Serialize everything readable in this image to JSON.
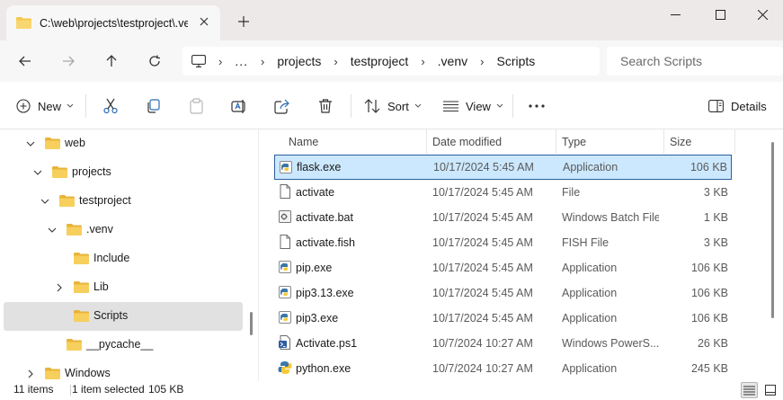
{
  "window": {
    "tab_title": "C:\\web\\projects\\testproject\\.venv\\Scripts",
    "colors": {
      "accent": "#0067c0",
      "folder": "#f4c84b",
      "selection": "#cce8ff",
      "selection_border": "#2b5f9e"
    }
  },
  "address": {
    "breadcrumbs": [
      "...",
      "projects",
      "testproject",
      ".venv",
      "Scripts"
    ],
    "search_placeholder": "Search Scripts"
  },
  "toolbar": {
    "new_label": "New",
    "sort_label": "Sort",
    "view_label": "View",
    "more_label": "...",
    "details_label": "Details"
  },
  "nav_tree": [
    {
      "label": "web",
      "expanded": true
    },
    {
      "label": "projects",
      "expanded": true
    },
    {
      "label": "testproject",
      "expanded": true
    },
    {
      "label": ".venv",
      "expanded": true
    },
    {
      "label": "Include",
      "expanded": null
    },
    {
      "label": "Lib",
      "expanded": false
    },
    {
      "label": "Scripts",
      "expanded": null,
      "selected": true
    },
    {
      "label": "__pycache__",
      "expanded": null
    },
    {
      "label": "Windows",
      "expanded": false
    }
  ],
  "columns": {
    "name": "Name",
    "date": "Date modified",
    "type": "Type",
    "size": "Size"
  },
  "files": [
    {
      "name": "flask.exe",
      "date": "10/17/2024 5:45 AM",
      "type": "Application",
      "size": "106 KB",
      "icon": "python-exe-icon",
      "selected": true
    },
    {
      "name": "activate",
      "date": "10/17/2024 5:45 AM",
      "type": "File",
      "size": "3 KB",
      "icon": "file-icon"
    },
    {
      "name": "activate.bat",
      "date": "10/17/2024 5:45 AM",
      "type": "Windows Batch File",
      "size": "1 KB",
      "icon": "batch-file-icon"
    },
    {
      "name": "activate.fish",
      "date": "10/17/2024 5:45 AM",
      "type": "FISH File",
      "size": "3 KB",
      "icon": "file-icon"
    },
    {
      "name": "pip.exe",
      "date": "10/17/2024 5:45 AM",
      "type": "Application",
      "size": "106 KB",
      "icon": "python-exe-icon"
    },
    {
      "name": "pip3.13.exe",
      "date": "10/17/2024 5:45 AM",
      "type": "Application",
      "size": "106 KB",
      "icon": "python-exe-icon"
    },
    {
      "name": "pip3.exe",
      "date": "10/17/2024 5:45 AM",
      "type": "Application",
      "size": "106 KB",
      "icon": "python-exe-icon"
    },
    {
      "name": "Activate.ps1",
      "date": "10/7/2024 10:27 AM",
      "type": "Windows PowerS...",
      "size": "26 KB",
      "icon": "powershell-script-icon"
    },
    {
      "name": "python.exe",
      "date": "10/7/2024 10:27 AM",
      "type": "Application",
      "size": "245 KB",
      "icon": "python-icon"
    }
  ],
  "status": {
    "item_count": "11 items",
    "selection": "1 item selected",
    "selection_size": "105 KB"
  }
}
